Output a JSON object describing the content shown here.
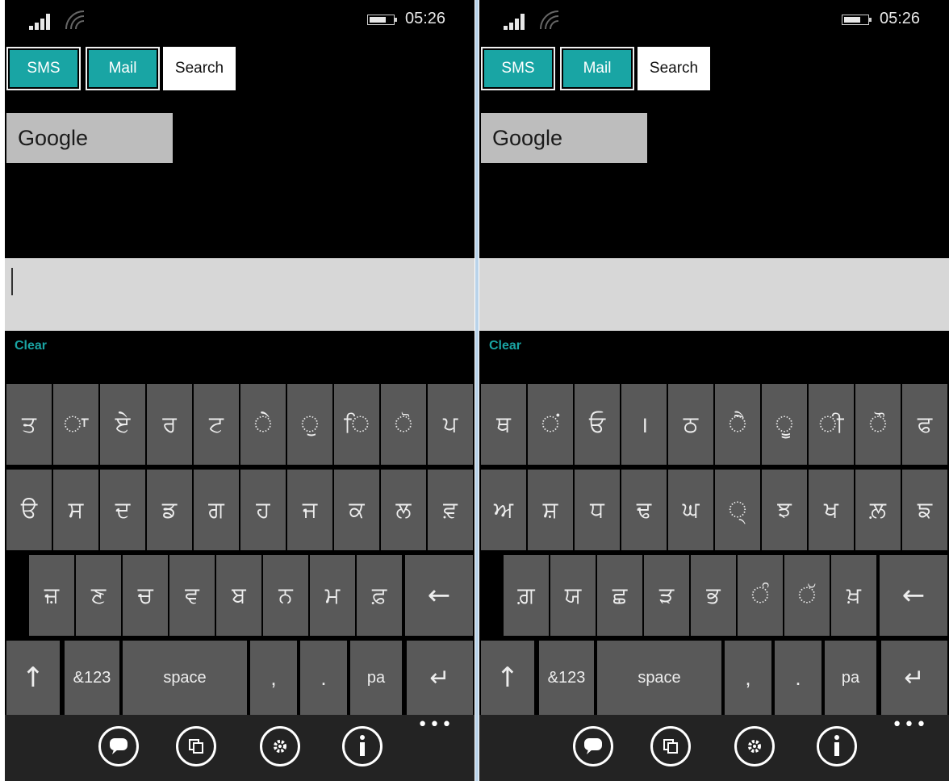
{
  "status": {
    "time": "05:26"
  },
  "buttons": {
    "sms": "SMS",
    "mail": "Mail",
    "search": "Search"
  },
  "engine": "Google",
  "clear": "Clear",
  "colors": {
    "teal": "#19a5a4",
    "key": "#595959",
    "appbar": "#232323"
  },
  "left": {
    "row1": [
      "ਤ",
      "ਾ",
      "ਏ",
      "ਰ",
      "ਟ",
      "ੇ",
      "ੁ",
      "ਿ",
      "ੋ",
      "ਪ"
    ],
    "row2": [
      "ੳ",
      "ਸ",
      "ਦ",
      "ਡ",
      "ਗ",
      "ਹ",
      "ਜ",
      "ਕ",
      "ਲ",
      "ਵ਼"
    ],
    "row3": [
      "ਜ਼",
      "ਣ",
      "ਚ",
      "ਵ",
      "ਬ",
      "ਨ",
      "ਮ",
      "ਫ਼"
    ]
  },
  "right": {
    "row1": [
      "ਥ",
      "ਂ",
      "ਓ",
      "।",
      "ਠ",
      "ੈ",
      "ੂ",
      "ੀ",
      "ੌ",
      "ਫ"
    ],
    "row2": [
      "ਅ",
      "ਸ਼",
      "ਧ",
      "ਢ",
      "ਘ",
      "੍",
      "ਝ",
      "ਖ",
      "ਲ਼",
      "ਙ"
    ],
    "row3": [
      "ਗ਼",
      "ਯ",
      "ਛ",
      "ੜ",
      "ਭ",
      "ੰ",
      "ੱ",
      "ਖ਼"
    ]
  },
  "bottom": {
    "symbols": "&123",
    "space": "space",
    "comma": ",",
    "period": ".",
    "lang": "pa",
    "backspace": "←",
    "shift": "↑",
    "enter": "↵"
  },
  "appbar": {
    "more": "•••",
    "icons": [
      "keyboard-icon",
      "copy-icon",
      "settings-icon",
      "info-icon"
    ]
  }
}
